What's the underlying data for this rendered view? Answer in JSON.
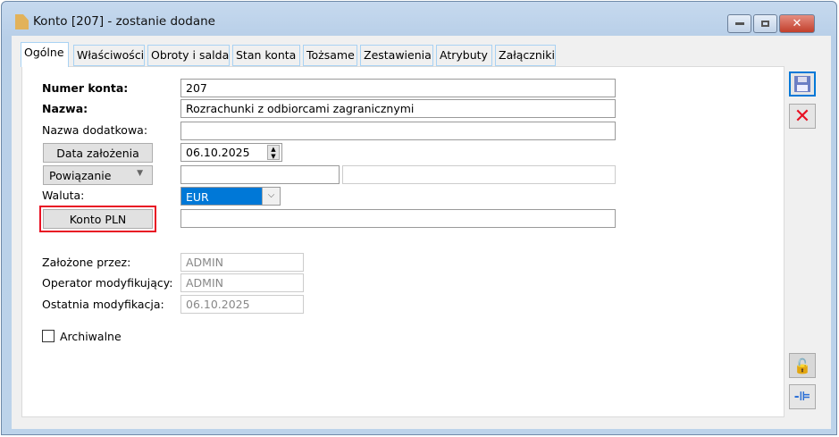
{
  "window": {
    "title": "Konto [207] - zostanie dodane"
  },
  "tabs": [
    "Ogólne",
    "Właściwości",
    "Obroty i salda",
    "Stan konta",
    "Tożsame",
    "Zestawienia",
    "Atrybuty",
    "Załączniki"
  ],
  "form": {
    "numer_label": "Numer konta:",
    "numer_value": "207",
    "nazwa_label": "Nazwa:",
    "nazwa_value": "Rozrachunki z odbiorcami zagranicznymi",
    "nazwa_dod_label": "Nazwa dodatkowa:",
    "nazwa_dod_value": "",
    "data_btn": "Data założenia",
    "data_value": "06.10.2025",
    "powiazanie_btn": "Powiązanie",
    "waluta_label": "Waluta:",
    "waluta_value": "EUR",
    "konto_pln_btn": "Konto PLN",
    "konto_pln_value": "",
    "zalozone_label": "Założone przez:",
    "zalozone_value": "ADMIN",
    "operator_label": "Operator modyfikujący:",
    "operator_value": "ADMIN",
    "ostatnia_label": "Ostatnia modyfikacja:",
    "ostatnia_value": "06.10.2025",
    "archiwalne_label": "Archiwalne",
    "archiwalne_checked": false
  },
  "colors": {
    "highlight": "#e81123",
    "selection": "#0078d7"
  }
}
